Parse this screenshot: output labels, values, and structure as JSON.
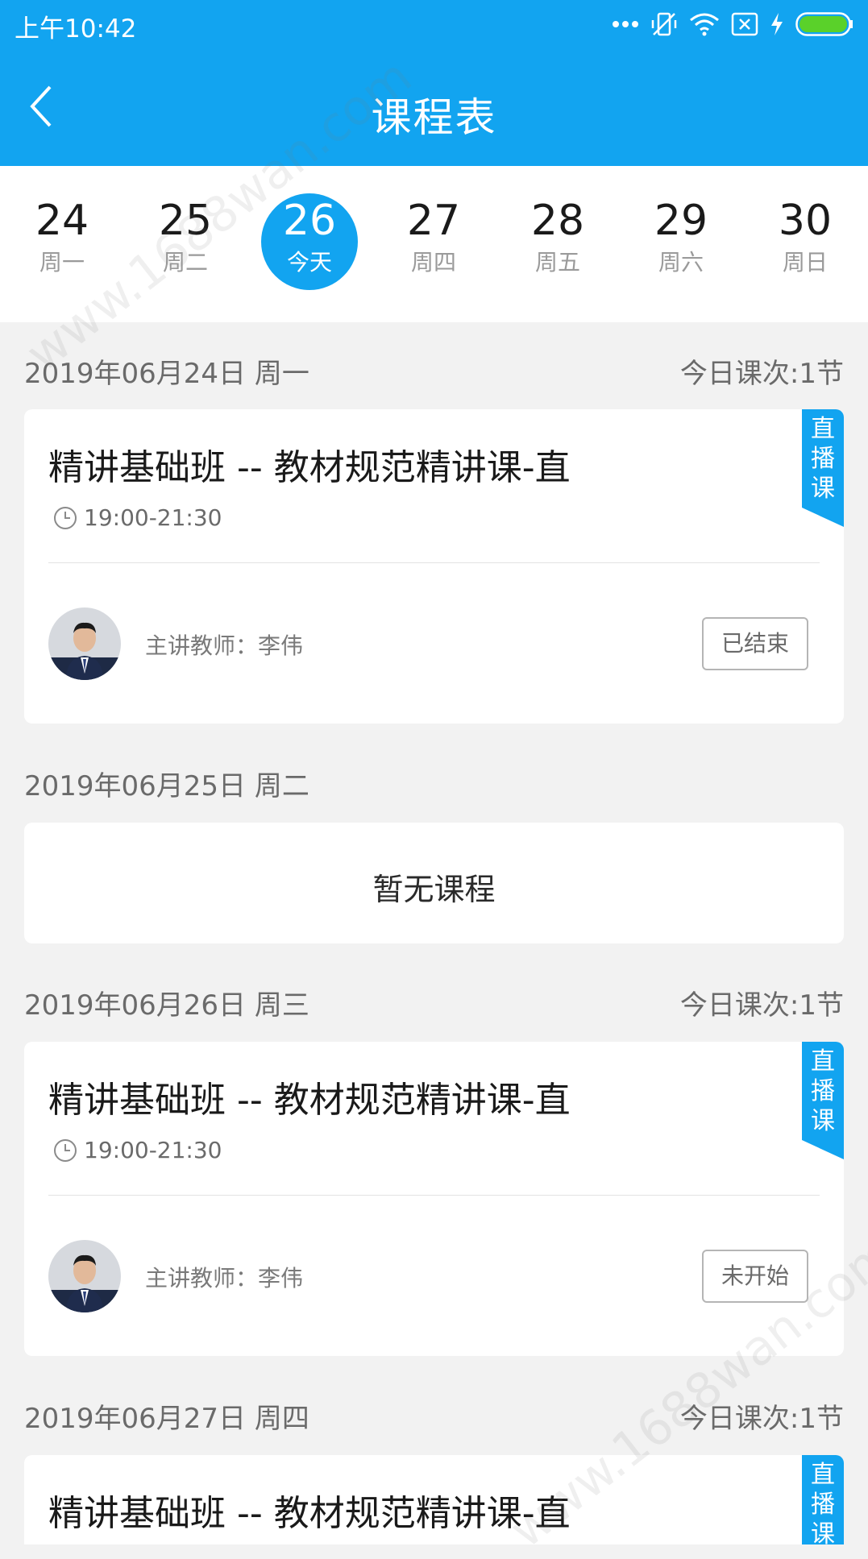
{
  "status_bar": {
    "time": "上午10:42"
  },
  "app_bar": {
    "title": "课程表"
  },
  "week": [
    {
      "day": "24",
      "weekday": "周一",
      "today": false
    },
    {
      "day": "25",
      "weekday": "周二",
      "today": false
    },
    {
      "day": "26",
      "weekday": "今天",
      "today": true
    },
    {
      "day": "27",
      "weekday": "周四",
      "today": false
    },
    {
      "day": "28",
      "weekday": "周五",
      "today": false
    },
    {
      "day": "29",
      "weekday": "周六",
      "today": false
    },
    {
      "day": "30",
      "weekday": "周日",
      "today": false
    }
  ],
  "days": [
    {
      "date": "2019年06月24日 周一",
      "count": "今日课次:1节",
      "course": {
        "title": "精讲基础班 -- 教材规范精讲课-直",
        "time": "19:00-21:30",
        "teacher": "主讲教师：李伟",
        "status": "已结束",
        "tag": "直播课"
      }
    },
    {
      "date": "2019年06月25日 周二",
      "empty_text": "暂无课程"
    },
    {
      "date": "2019年06月26日 周三",
      "count": "今日课次:1节",
      "course": {
        "title": "精讲基础班 -- 教材规范精讲课-直",
        "time": "19:00-21:30",
        "teacher": "主讲教师：李伟",
        "status": "未开始",
        "tag": "直播课"
      }
    },
    {
      "date": "2019年06月27日 周四",
      "count": "今日课次:1节",
      "course": {
        "title": "精讲基础班 -- 教材规范精讲课-直",
        "tag": "直播课"
      }
    }
  ],
  "watermark": "www.1688wan.com",
  "colors": {
    "primary": "#12a4f0",
    "background": "#f2f2f2"
  }
}
